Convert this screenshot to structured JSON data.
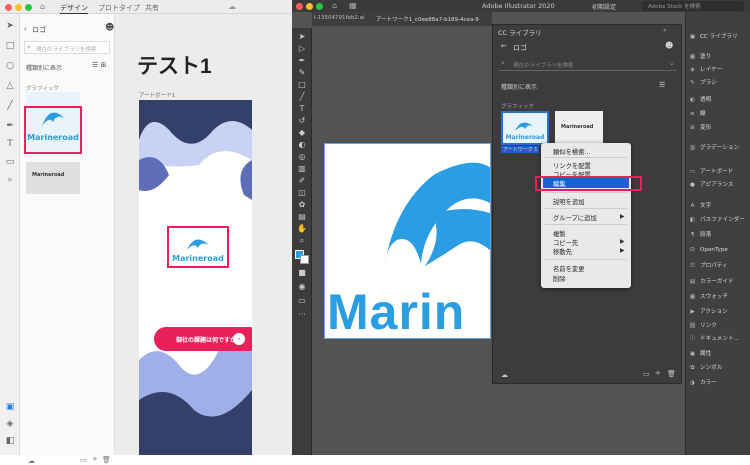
{
  "xd": {
    "tabs": [
      "デザイン",
      "プロトタイプ",
      "共有"
    ],
    "lib_back": "ロゴ",
    "search_placeholder": "現在のライブラリを検索",
    "sort_label": "種類別に表示",
    "graphic_section": "グラフィック",
    "artboard_title": "テスト1",
    "artboard_label": "アートボード1",
    "logo_text": "Marineroad",
    "cta_button": "御社の課題は何ですか？"
  },
  "ai": {
    "app_title": "Adobe Illustrator 2020",
    "workspace": "初期設定",
    "stock_search": "Adobe Stock を検索",
    "doc_tabs": [
      "l-13504791feb2.ai",
      "アートワーク1_c0ee88a7-b189-4cea-9"
    ],
    "cc_panel_title": "CC ライブラリ",
    "cc_back": "ロゴ",
    "cc_search_placeholder": "現在のライブラリを検索",
    "cc_sort": "種類別に表示",
    "cc_graphic_section": "グラフィック",
    "thumb_caption": "アートワーク 1",
    "canvas_text": "Marin",
    "context_menu": {
      "g1": [
        "類似を検索..."
      ],
      "g2": [
        "リンクを配置",
        "コピーを配置",
        "編集"
      ],
      "g3": [
        "説明を追加"
      ],
      "g4": [
        "グループに追加"
      ],
      "g5": [
        "複製",
        "コピー先",
        "移動先"
      ],
      "g6": [
        "名前を変更",
        "削除"
      ]
    },
    "right_panel": [
      "CC ライブラリ",
      "塗り",
      "レイヤー",
      "ブラシ",
      "透明",
      "線",
      "変形",
      "グラデーション",
      "アートボード",
      "アピアランス",
      "文字",
      "パスファインダー",
      "段落",
      "OpenType",
      "プロパティ",
      "カラーガイド",
      "スウォッチ",
      "アクション",
      "リンク",
      "ドキュメント...",
      "属性",
      "シンボル",
      "カラー"
    ]
  },
  "colors": {
    "accent_pink": "#e8215b",
    "logo_blue": "#2b9ee3",
    "highlight_blue": "#1e5fd6"
  }
}
